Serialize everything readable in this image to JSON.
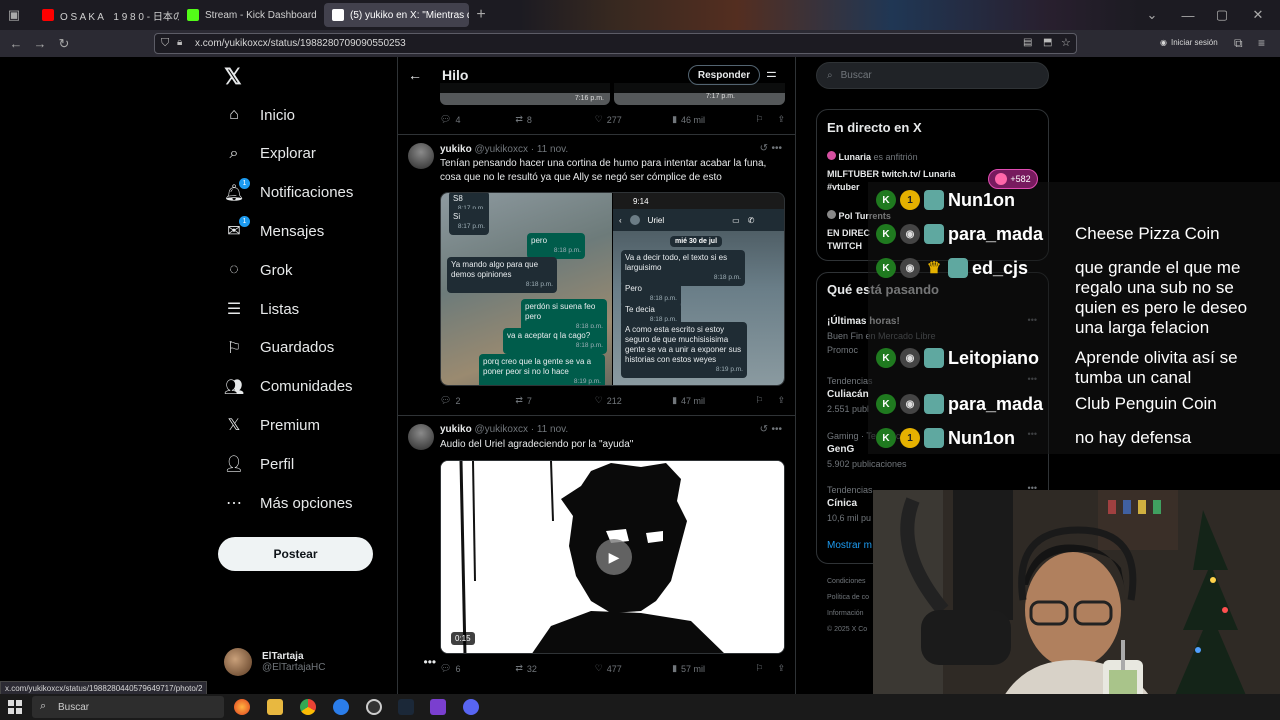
{
  "browser": {
    "tabs": [
      {
        "label": "O S A K A　1 9 8 0 - 日本のシテ",
        "icon_color": "#ff0000"
      },
      {
        "label": "Stream - Kick Dashboard",
        "icon_color": "#53fc18"
      },
      {
        "label": "(5) yukiko en X: \"Mientras que l",
        "icon_color": "#ffffff"
      }
    ],
    "url": "x.com/yukikoxcx/status/1988280709090550253",
    "sign_in": "Iniciar sesión"
  },
  "sidebar": {
    "items": [
      {
        "label": "Inicio",
        "icon": "home-icon"
      },
      {
        "label": "Explorar",
        "icon": "search-icon"
      },
      {
        "label": "Notificaciones",
        "icon": "bell-icon",
        "badge": "1"
      },
      {
        "label": "Mensajes",
        "icon": "mail-icon",
        "badge": "1"
      },
      {
        "label": "Grok",
        "icon": "grok-icon"
      },
      {
        "label": "Listas",
        "icon": "list-icon"
      },
      {
        "label": "Guardados",
        "icon": "bookmark-icon"
      },
      {
        "label": "Comunidades",
        "icon": "people-icon"
      },
      {
        "label": "Premium",
        "icon": "x-logo-icon"
      },
      {
        "label": "Perfil",
        "icon": "person-icon"
      },
      {
        "label": "Más opciones",
        "icon": "more-circle-icon"
      }
    ],
    "post_label": "Postear",
    "account": {
      "name": "ElTartaja",
      "handle": "@ElTartajaHC"
    }
  },
  "thread": {
    "title": "Hilo",
    "reply_label": "Responder",
    "top_stats": {
      "replies": "4",
      "reposts": "8",
      "likes": "277",
      "views": "46 mil"
    },
    "top_times": [
      "7:16 p.m.",
      "7:17 p.m."
    ],
    "tweets": [
      {
        "name": "yukiko",
        "handle": "@yukikoxcx",
        "date": "· 11 nov.",
        "text": "Tenían pensando hacer una cortina de humo para intentar acabar la funa, cosa que no le resultó ya que Ally se negó ser cómplice de esto",
        "stats": {
          "replies": "2",
          "reposts": "7",
          "likes": "212",
          "views": "47 mil"
        },
        "chat_left": [
          {
            "text": "S8",
            "time": "8:17 p.m."
          },
          {
            "text": "Si",
            "time": "8:17 p.m."
          },
          {
            "text": "pero",
            "time": "8:18 p.m."
          },
          {
            "text": "Ya mando algo para que demos opiniones",
            "time": "8:18 p.m."
          },
          {
            "text": "perdón si suena feo pero",
            "time": "8:18 p.m."
          },
          {
            "text": "va a aceptar q la cago?",
            "time": "8:18 p.m."
          },
          {
            "text": "porq creo que la gente se va a poner peor si no lo hace",
            "time": "8:19 p.m."
          }
        ],
        "chat_right": {
          "clock": "9:14",
          "contact": "Uriel",
          "date_chip": "mié 30 de jul",
          "messages": [
            {
              "text": "Va a decir todo, el texto si es larguisimo",
              "time": "8:18 p.m."
            },
            {
              "text": "Pero",
              "time": "8:18 p.m."
            },
            {
              "text": "Te decia",
              "time": "8:18 p.m."
            },
            {
              "text": "A como esta escrito si estoy seguro de que muchisisisima gente se va a unir a exponer sus historias con estos weyes",
              "time": "8:19 p.m."
            }
          ]
        }
      },
      {
        "name": "yukiko",
        "handle": "@yukikoxcx",
        "date": "· 11 nov.",
        "text": "Audio del Uriel agradeciendo por la \"ayuda\"",
        "duration": "0:15",
        "stats": {
          "replies": "6",
          "reposts": "32",
          "likes": "477",
          "views": "57 mil"
        }
      }
    ]
  },
  "right": {
    "search_placeholder": "Buscar",
    "live": {
      "title": "En directo en X",
      "host1": "Lunaria",
      "host_suffix": "es anfitrión",
      "live1_text": "MILFTUBER twitch.tv/ Lunaria #vtuber",
      "host2": "Pol Turrents",
      "live2_text": "EN DIREC TWITCH"
    },
    "trends": {
      "title": "Qué está pasando",
      "items": [
        {
          "meta": "",
          "name": "¡Últimas horas!",
          "sub": "Buen Fin en Mercado Libre",
          "extra": "Promoc"
        },
        {
          "meta": "Tendencias",
          "name": "Culiacán",
          "sub": "2.551 publ"
        },
        {
          "meta": "Gaming · Tendencia",
          "name": "GenG",
          "sub": "5.902 publicaciones"
        },
        {
          "meta": "Tendencias",
          "name": "Cínica",
          "sub": "10,6 mil pu"
        }
      ],
      "show_more": "Mostrar m"
    },
    "footer": [
      "Condiciones",
      "Política de co",
      "Información",
      "© 2025 X Co"
    ]
  },
  "stream": {
    "viewer_count": "+582",
    "chat": [
      {
        "user": "Nun1on",
        "msg": "",
        "badges": [
          "k",
          "one",
          "st"
        ]
      },
      {
        "user": "para_mada",
        "msg": "Cheese Pizza Coin",
        "badges": [
          "k",
          "av",
          "st"
        ]
      },
      {
        "user": "ed_cjs",
        "msg": "que grande el que me regalo una sub no se quien es pero le deseo una larga felacion",
        "badges": [
          "k",
          "av",
          "crown",
          "st"
        ]
      },
      {
        "user": "Leitopiano",
        "msg": "Aprende olivita así se tumba un canal",
        "badges": [
          "k",
          "av",
          "st"
        ]
      },
      {
        "user": "para_mada",
        "msg": "Club Penguin Coin",
        "badges": [
          "k",
          "av",
          "st"
        ]
      },
      {
        "user": "Nun1on",
        "msg": "no hay defensa",
        "badges": [
          "k",
          "one",
          "st"
        ]
      }
    ]
  },
  "status_link": "x.com/yukikoxcx/status/1988280440579649717/photo/2",
  "taskbar": {
    "search_label": "Buscar"
  }
}
